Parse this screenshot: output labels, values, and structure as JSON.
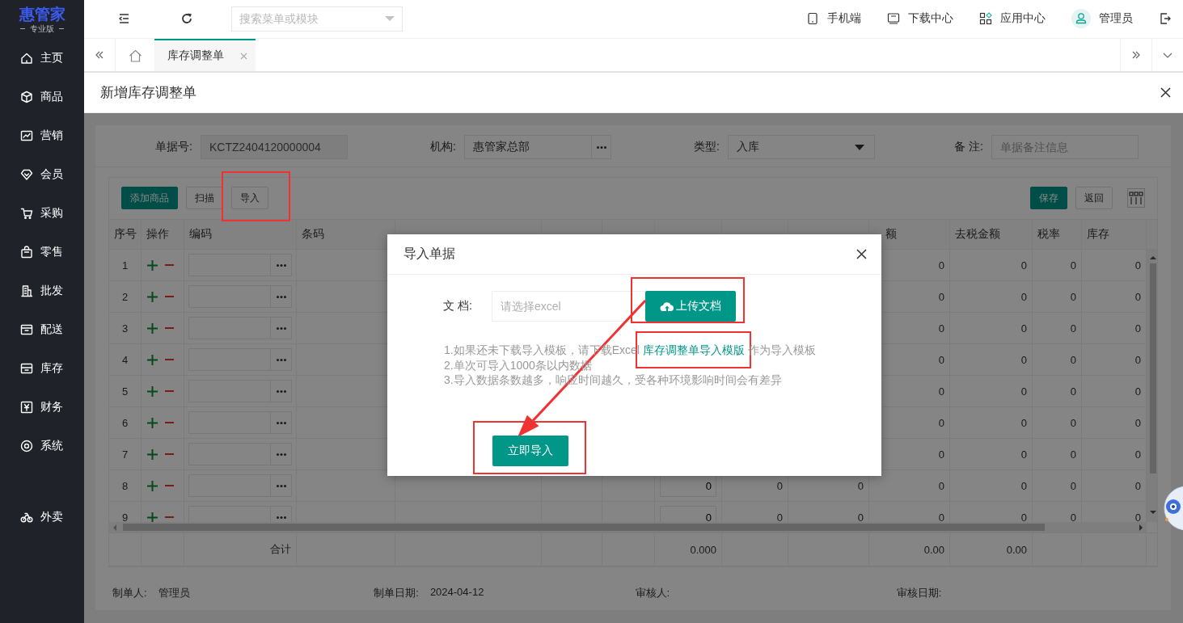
{
  "sidebar": {
    "logo": "惠管家",
    "edition": "专业版",
    "items": [
      {
        "label": "主页",
        "selected": false
      },
      {
        "label": "商品",
        "selected": false
      },
      {
        "label": "营销",
        "selected": false
      },
      {
        "label": "会员",
        "selected": false
      },
      {
        "label": "采购",
        "selected": false
      },
      {
        "label": "零售",
        "selected": false
      },
      {
        "label": "批发",
        "selected": false
      },
      {
        "label": "配送",
        "selected": false
      },
      {
        "label": "库存",
        "selected": false
      },
      {
        "label": "财务",
        "selected": false
      },
      {
        "label": "系统",
        "selected": false
      }
    ],
    "bottom_items": [
      {
        "label": "外卖",
        "selected": false
      }
    ]
  },
  "topbar": {
    "search": {
      "placeholder": "搜索菜单或模块"
    },
    "links": [
      {
        "label": "手机端"
      },
      {
        "label": "下载中心"
      },
      {
        "label": "应用中心"
      }
    ],
    "user": "管理员"
  },
  "tabs": [
    {
      "kind": "home",
      "selected": false
    },
    {
      "kind": "page",
      "label": "库存调整单",
      "selected": true
    }
  ],
  "page": {
    "title": "新增库存调整单"
  },
  "form": {
    "fields": [
      {
        "kind": "readonly",
        "label": "单据号:",
        "value": "KCTZ2404120000004"
      },
      {
        "kind": "picker",
        "label": "机构:",
        "value": "惠管家总部"
      },
      {
        "kind": "select",
        "label": "类型:",
        "value": "入库"
      },
      {
        "kind": "text",
        "label": "备 注:",
        "placeholder": "单据备注信息"
      }
    ]
  },
  "toolbar": {
    "left": [
      {
        "label": "添加商品",
        "kind": "primary"
      },
      {
        "label": "扫描",
        "kind": "default"
      },
      {
        "label": "导入",
        "kind": "default"
      }
    ],
    "right": [
      {
        "label": "保存",
        "kind": "primary"
      },
      {
        "label": "返回",
        "kind": "default"
      }
    ]
  },
  "table": {
    "columns": [
      {
        "label": "序号"
      },
      {
        "label": "操作"
      },
      {
        "label": "编码"
      },
      {
        "label": "条码"
      },
      {
        "label": "额"
      },
      {
        "label": "去税金额"
      },
      {
        "label": "税率"
      },
      {
        "label": "库存"
      }
    ],
    "rows": [
      {
        "no": "1",
        "amount": "0",
        "amount_ex_tax": "0",
        "tax_rate": "0",
        "stock": "0"
      },
      {
        "no": "2",
        "amount": "0",
        "amount_ex_tax": "0",
        "tax_rate": "0",
        "stock": "0"
      },
      {
        "no": "3",
        "amount": "0",
        "amount_ex_tax": "0",
        "tax_rate": "0",
        "stock": "0"
      },
      {
        "no": "4",
        "amount": "0",
        "amount_ex_tax": "0",
        "tax_rate": "0",
        "stock": "0"
      },
      {
        "no": "5",
        "amount": "0",
        "amount_ex_tax": "0",
        "tax_rate": "0",
        "stock": "0"
      },
      {
        "no": "6",
        "amount": "0",
        "amount_ex_tax": "0",
        "tax_rate": "0",
        "stock": "0"
      },
      {
        "no": "7",
        "amount": "0",
        "amount_ex_tax": "0",
        "tax_rate": "0",
        "stock": "0"
      },
      {
        "no": "8",
        "qty": "0",
        "cost": "0",
        "cost_ex_tax": "0",
        "amount": "0",
        "amount_ex_tax": "0",
        "tax_rate": "0",
        "stock": "0"
      },
      {
        "no": "9",
        "qty": "0",
        "cost": "0",
        "cost_ex_tax": "0",
        "amount": "0",
        "amount_ex_tax": "0",
        "tax_rate": "0",
        "stock": "0"
      }
    ],
    "totals": {
      "label": "合计",
      "qty": "0.000",
      "amount": "0.00",
      "amount_ex_tax": "0.00"
    }
  },
  "footer": [
    {
      "label": "制单人:",
      "value": "管理员"
    },
    {
      "label": "制单日期:",
      "value": "2024-04-12"
    },
    {
      "label": "审核人:"
    },
    {
      "label": "审核日期:"
    }
  ],
  "dialog": {
    "title": "导入单据",
    "file_label": "文 档:",
    "file_placeholder": "请选择excel",
    "upload_button": "上传文档",
    "notes": [
      {
        "before": "1.如果还未下载导入模板，请下载Excel ",
        "link": "库存调整单导入模版",
        "after": " 作为导入模板"
      },
      {
        "text": "2.单次可导入1000条以内数据"
      },
      {
        "text": "3.导入数据条数越多，响应时间越久，受各种环境影响时间会有差异"
      }
    ],
    "submit_button": "立即导入"
  },
  "annotations": [
    {
      "kind": "box"
    },
    {
      "kind": "box"
    },
    {
      "kind": "box"
    },
    {
      "kind": "box"
    },
    {
      "kind": "arrow"
    }
  ]
}
